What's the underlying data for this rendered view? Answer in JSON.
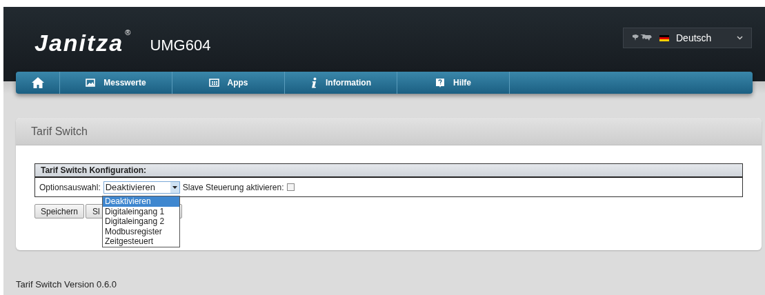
{
  "header": {
    "logo": "Janitza",
    "logo_mark": "®",
    "device": "UMG604",
    "language": {
      "label": "Deutsch"
    }
  },
  "nav": [
    {
      "kind": "home"
    },
    {
      "kind": "chart",
      "label": "Messwerte"
    },
    {
      "kind": "apps",
      "label": "Apps"
    },
    {
      "kind": "info",
      "label": "Information"
    },
    {
      "kind": "help",
      "label": "Hilfe"
    }
  ],
  "panel": {
    "title": "Tarif Switch",
    "config": {
      "heading": "Tarif Switch Konfiguration:",
      "option_label": "Optionsauswahl:",
      "option_value": "Deaktivieren",
      "slave_label": "Slave Steuerung aktivieren:",
      "slave_checked": false
    },
    "dropdown": [
      {
        "label": "Deaktivieren",
        "selected": true
      },
      {
        "label": "Digitaleingang 1",
        "selected": false
      },
      {
        "label": "Digitaleingang 2",
        "selected": false
      },
      {
        "label": "Modbusregister",
        "selected": false
      },
      {
        "label": "Zeitgesteuert",
        "selected": false
      }
    ],
    "buttons": [
      "Speichern",
      "Sl"
    ]
  },
  "footer": "Tarif Switch Version 0.6.0"
}
